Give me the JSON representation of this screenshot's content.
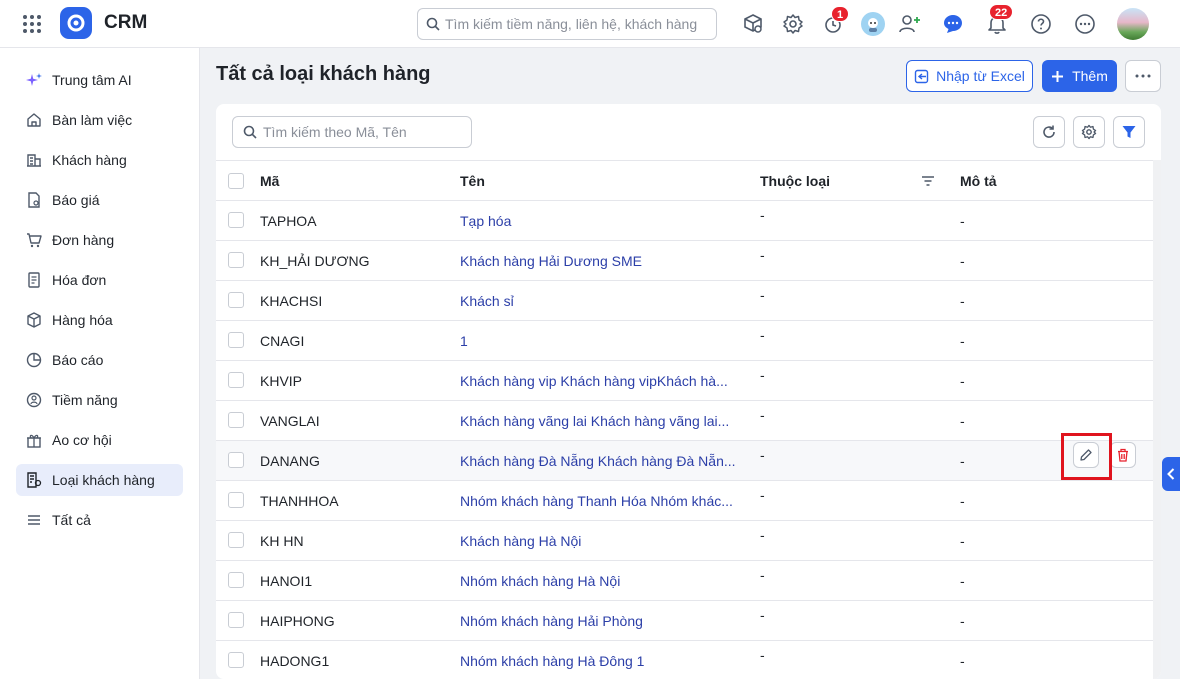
{
  "app": {
    "title": "CRM",
    "brand_color": "#2c64e8"
  },
  "topbar": {
    "search_placeholder": "Tìm kiếm tiềm năng, liên hệ, khách hàng",
    "timer_badge": "1",
    "notification_badge": "22",
    "icons": [
      "apps-grid-icon",
      "cube-search-icon",
      "gear-icon",
      "alarm-clock-icon",
      "bot-avatar",
      "add-user-icon",
      "chat-icon",
      "bell-icon",
      "help-icon",
      "more-icon",
      "user-avatar"
    ]
  },
  "sidebar": {
    "items": [
      {
        "label": "Trung tâm AI",
        "icon": "sparkle-icon"
      },
      {
        "label": "Bàn làm việc",
        "icon": "home-icon"
      },
      {
        "label": "Khách hàng",
        "icon": "building-icon"
      },
      {
        "label": "Báo giá",
        "icon": "quote-doc-icon"
      },
      {
        "label": "Đơn hàng",
        "icon": "cart-icon"
      },
      {
        "label": "Hóa đơn",
        "icon": "invoice-icon"
      },
      {
        "label": "Hàng hóa",
        "icon": "box-icon"
      },
      {
        "label": "Báo cáo",
        "icon": "pie-chart-icon"
      },
      {
        "label": "Tiềm năng",
        "icon": "target-icon"
      },
      {
        "label": "Ao cơ hội",
        "icon": "gift-icon"
      },
      {
        "label": "Loại khách hàng",
        "icon": "customer-type-icon",
        "active": true
      },
      {
        "label": "Tất cả",
        "icon": "menu-icon"
      }
    ]
  },
  "page": {
    "title": "Tất cả loại khách hàng",
    "import_label": "Nhập từ Excel",
    "add_label": "Thêm"
  },
  "table": {
    "search_placeholder": "Tìm kiếm theo Mã, Tên",
    "columns": [
      "Mã",
      "Tên",
      "Thuộc loại",
      "Mô tả"
    ],
    "rows": [
      {
        "code": "TAPHOA",
        "name": "Tạp hóa",
        "parent": "-",
        "desc": "-"
      },
      {
        "code": "KH_HẢI DƯƠNG",
        "name": "Khách hàng Hải Dương SME",
        "parent": "-",
        "desc": "-"
      },
      {
        "code": "KHACHSI",
        "name": "Khách sỉ",
        "parent": "-",
        "desc": "-"
      },
      {
        "code": "CNAGI",
        "name": "1",
        "parent": "-",
        "desc": "-"
      },
      {
        "code": "KHVIP",
        "name": "Khách hàng vip Khách hàng vipKhách hà...",
        "parent": "-",
        "desc": "-"
      },
      {
        "code": "VANGLAI",
        "name": "Khách hàng vãng lai Khách hàng vãng lai...",
        "parent": "-",
        "desc": "-"
      },
      {
        "code": "DANANG",
        "name": "Khách hàng Đà Nẵng Khách hàng Đà Nẵn...",
        "parent": "-",
        "desc": "-"
      },
      {
        "code": "THANHHOA",
        "name": "Nhóm khách hàng Thanh Hóa Nhóm khác...",
        "parent": "-",
        "desc": "-"
      },
      {
        "code": "KH HN",
        "name": "Khách hàng Hà Nội",
        "parent": "-",
        "desc": "-"
      },
      {
        "code": "HANOI1",
        "name": "Nhóm khách hàng Hà Nội",
        "parent": "-",
        "desc": "-"
      },
      {
        "code": "HAIPHONG",
        "name": "Nhóm khách hàng Hải Phòng",
        "parent": "-",
        "desc": "-"
      },
      {
        "code": "HADONG1",
        "name": "Nhóm khách hàng Hà Đông 1",
        "parent": "-",
        "desc": "-"
      }
    ]
  }
}
